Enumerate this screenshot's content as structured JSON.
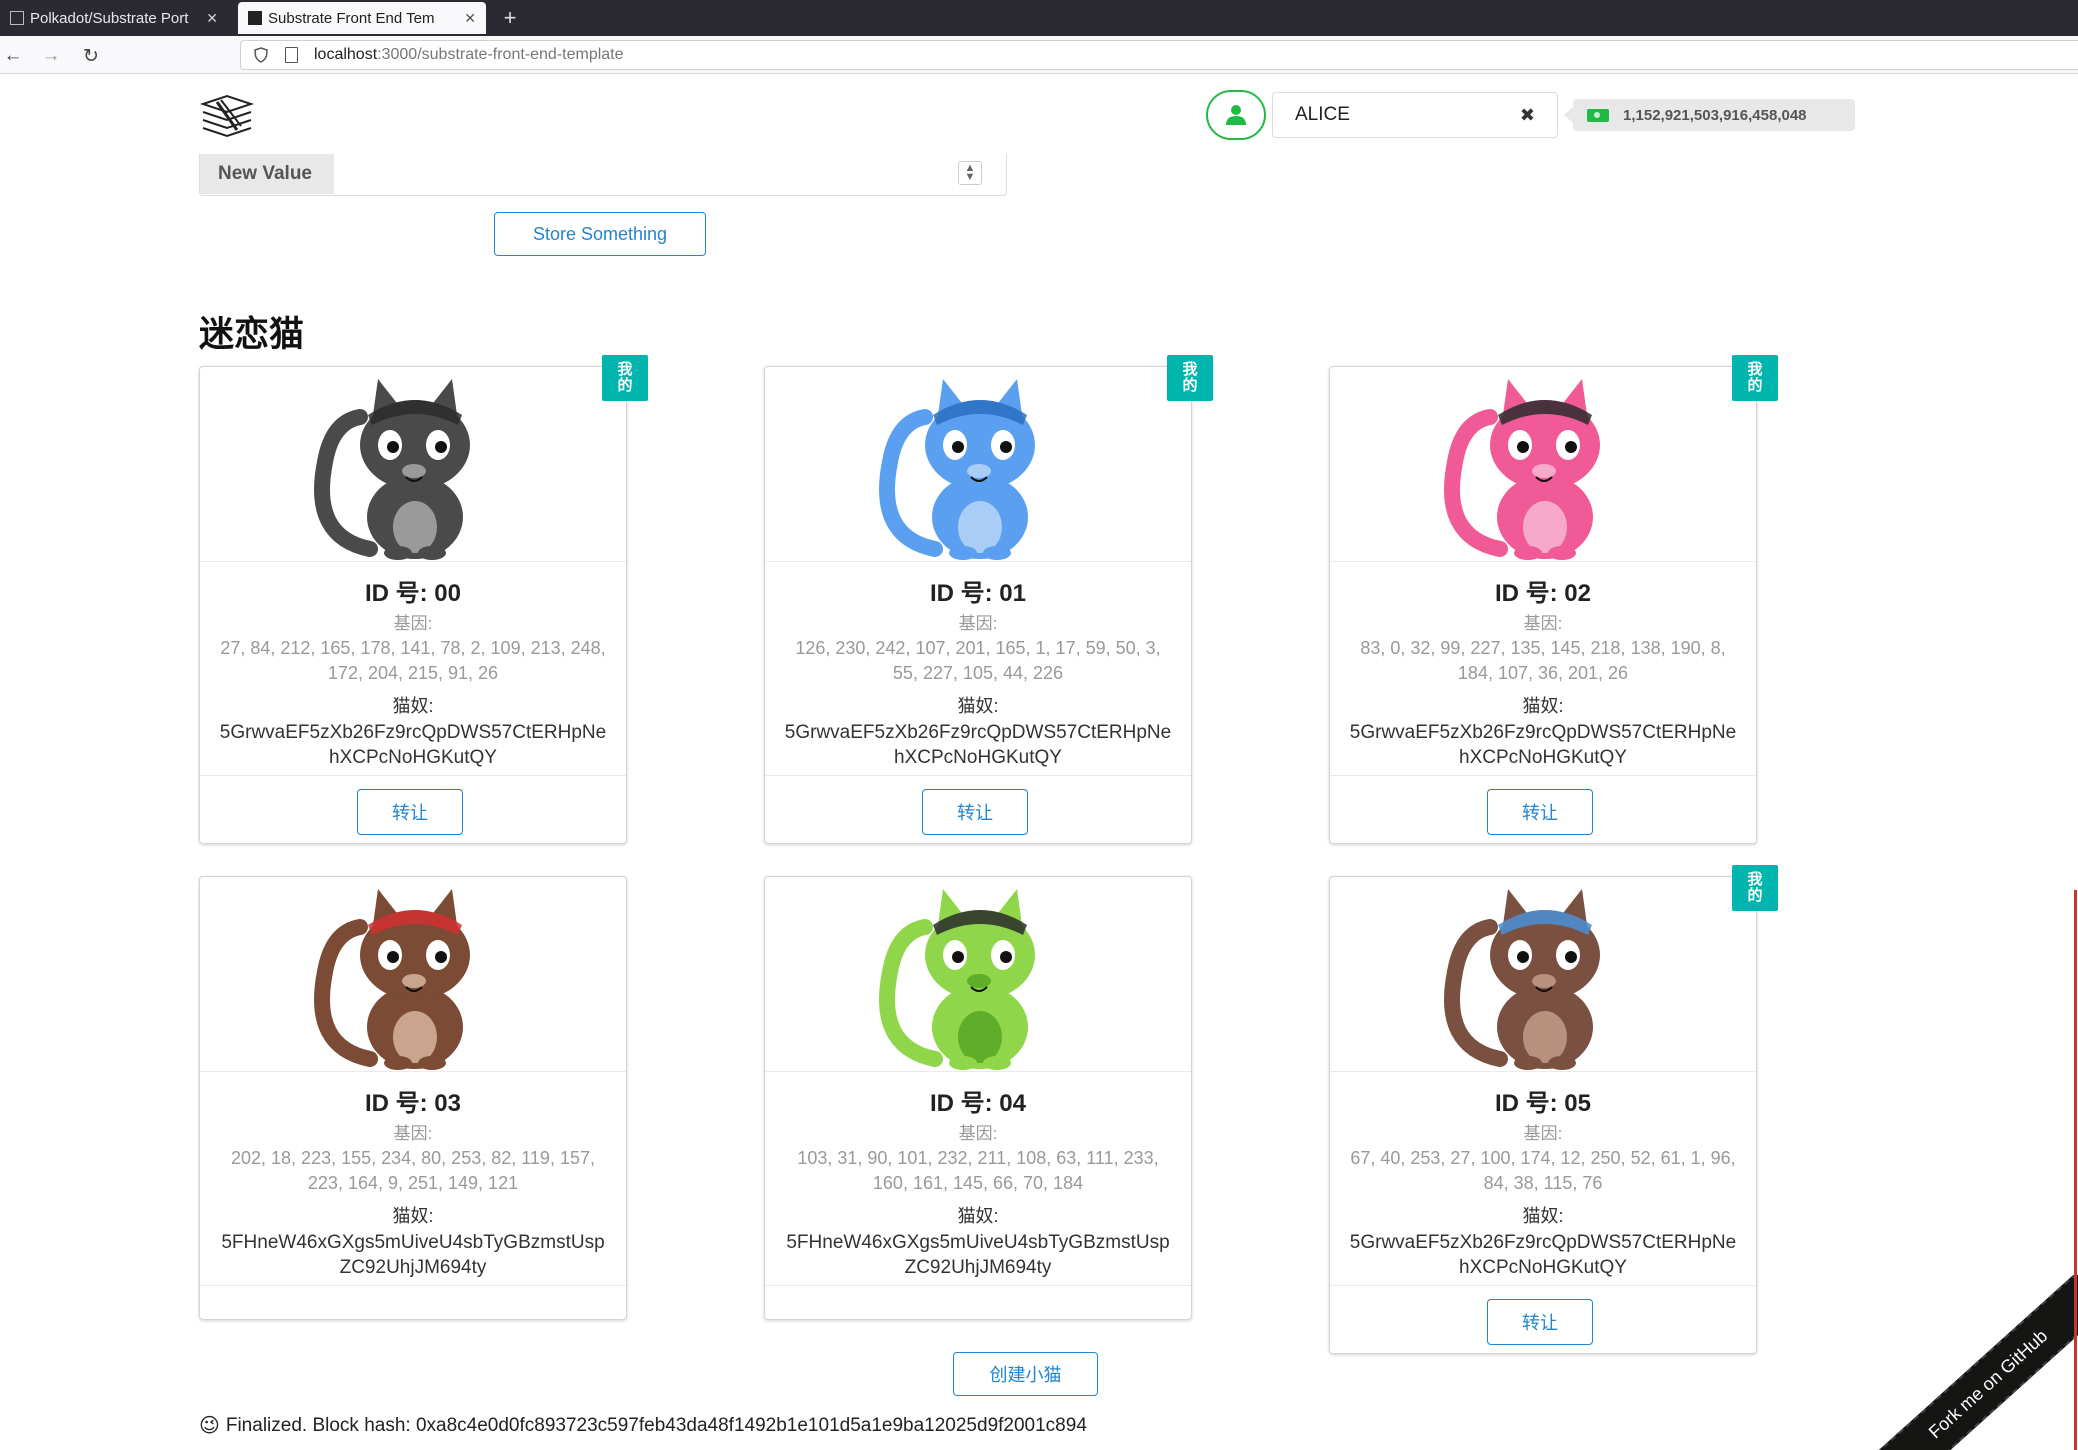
{
  "browser": {
    "tabs": [
      {
        "label": "Polkadot/Substrate Port",
        "active": false
      },
      {
        "label": "Substrate Front End Tem",
        "active": true
      }
    ],
    "new_tab": "+",
    "nav": {
      "back": "←",
      "forward": "→",
      "reload": "↻"
    },
    "url_host": "localhost",
    "url_path": ":3000/substrate-front-end-template"
  },
  "header": {
    "account_name": "ALICE",
    "clear": "✖",
    "balance": "1,152,921,503,916,458,048"
  },
  "form": {
    "input_label": "New Value",
    "submit_label": "Store Something"
  },
  "section_title": "迷恋猫",
  "labels": {
    "dna": "基因:",
    "owner": "猫奴:",
    "transfer": "转让",
    "mine_badge": [
      "我",
      "的"
    ]
  },
  "kitties": [
    {
      "id": "ID 号: 00",
      "dna": "27, 84, 212, 165, 178, 141, 78, 2, 109, 213, 248, 172, 204, 215, 91, 26",
      "owner": "5GrwvaEF5zXb26Fz9rcQpDWS57CtERHpNehXCPcNoHGKutQY",
      "mine": true,
      "colors": {
        "body": "#4a4a4a",
        "patch": "#9a9a9a",
        "accent": "#2b2b2b"
      }
    },
    {
      "id": "ID 号: 01",
      "dna": "126, 230, 242, 107, 201, 165, 1, 17, 59, 50, 3, 55, 227, 105, 44, 226",
      "owner": "5GrwvaEF5zXb26Fz9rcQpDWS57CtERHpNehXCPcNoHGKutQY",
      "mine": true,
      "colors": {
        "body": "#5b9ff0",
        "patch": "#a9cdf6",
        "accent": "#2c6fc0"
      }
    },
    {
      "id": "ID 号: 02",
      "dna": "83, 0, 32, 99, 227, 135, 145, 218, 138, 190, 8, 184, 107, 36, 201, 26",
      "owner": "5GrwvaEF5zXb26Fz9rcQpDWS57CtERHpNehXCPcNoHGKutQY",
      "mine": true,
      "colors": {
        "body": "#f05a97",
        "patch": "#f7a9c9",
        "accent": "#2b2b2b"
      }
    },
    {
      "id": "ID 号: 03",
      "dna": "202, 18, 223, 155, 234, 80, 253, 82, 119, 157, 223, 164, 9, 251, 149, 121",
      "owner": "5FHneW46xGXgs5mUiveU4sbTyGBzmstUspZC92UhjJM694ty",
      "mine": false,
      "colors": {
        "body": "#7b4b35",
        "patch": "#c9a590",
        "accent": "#d2302f"
      }
    },
    {
      "id": "ID 号: 04",
      "dna": "103, 31, 90, 101, 232, 211, 108, 63, 111, 233, 160, 161, 145, 66, 70, 184",
      "owner": "5FHneW46xGXgs5mUiveU4sbTyGBzmstUspZC92UhjJM694ty",
      "mine": false,
      "colors": {
        "body": "#8fd64a",
        "patch": "#5fae2a",
        "accent": "#2b2b2b"
      }
    },
    {
      "id": "ID 号: 05",
      "dna": "67, 40, 253, 27, 100, 174, 12, 250, 52, 61, 1, 96, 84, 38, 115, 76",
      "owner": "5GrwvaEF5zXb26Fz9rcQpDWS57CtERHpNehXCPcNoHGKutQY",
      "mine": true,
      "colors": {
        "body": "#7a5140",
        "patch": "#b8917e",
        "accent": "#4a8fd8"
      }
    }
  ],
  "create_label": "创建小猫",
  "status": {
    "emoji": "😉",
    "text": "Finalized. Block hash: 0xa8c4e0d0fc893723c597feb43da48f1492b1e101d5a1e9ba12025d9f2001c894"
  },
  "fork_ribbon": "Fork me on GitHub"
}
